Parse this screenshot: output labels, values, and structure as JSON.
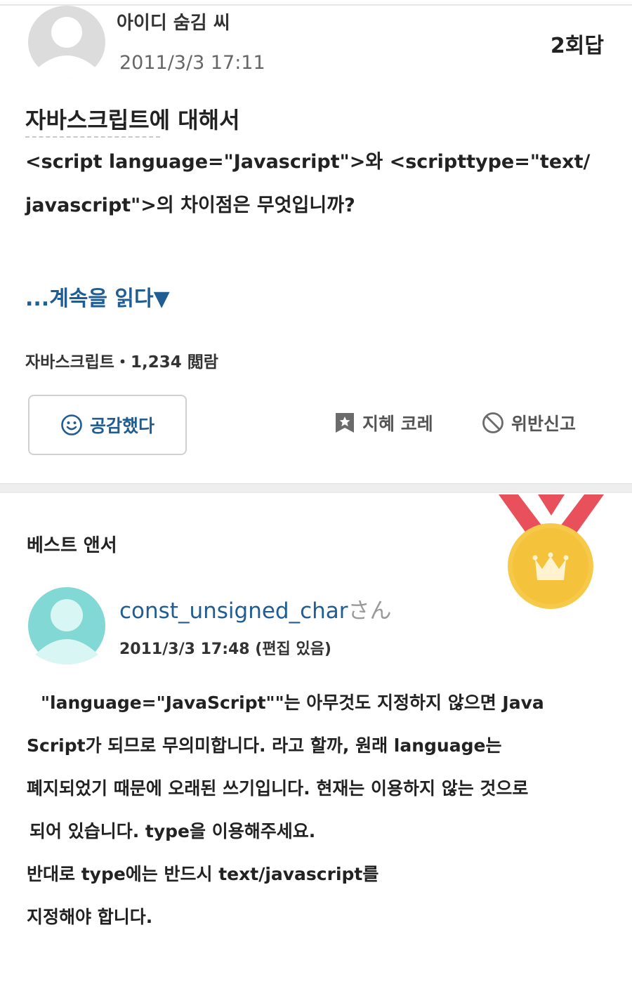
{
  "question": {
    "username": "아이디 숨김 씨",
    "date": "2011/3/3 17:11",
    "answer_count": "2회답",
    "title": "자바스크립트에 대해서",
    "body_lines": [
      "<script language=\"Javascript\">와 <scripttype=\"text/",
      "javascript\">의 차이점은 무엇입니까?"
    ],
    "read_more": "...계속을 읽다▼",
    "meta": "자바스크립트・1,234 閲람",
    "actions": {
      "empathy_label": "공감했다",
      "chiebukuro_label": "지혜 코레",
      "report_label": "위반신고"
    }
  },
  "best_answer": {
    "section_label": "베스트 앤서",
    "username": "const_unsigned_char",
    "username_suffix": "さん",
    "date": "2011/3/3 17:48 (편집 있음)",
    "body_lines": [
      "\"language=\"JavaScript\"\"는 아무것도 지정하지 않으면 Java",
      "Script가 되므로 무의미합니다. 라고 할까, 원래 language는",
      "폐지되었기 때문에 오래된 쓰기입니다. 현재는 이용하지 않는 것으로",
      "되어 있습니다. type을 이용해주세요.",
      "반대로 type에는 반드시 text/javascript를",
      "지정해야 합니다."
    ]
  },
  "colors": {
    "link_blue": "#1f5d93",
    "avatar_gray": "#dcdcdc",
    "avatar_teal": "#82d8d4",
    "medal_gold": "#f7c948",
    "ribbon_red": "#e8505b"
  },
  "icons": {
    "question_avatar": "user-avatar-icon",
    "answer_avatar": "user-avatar-icon",
    "empathy": "smiley-icon",
    "chiebukuro": "bookmark-star-icon",
    "report": "prohibited-icon",
    "medal": "gold-medal-crown-icon"
  }
}
